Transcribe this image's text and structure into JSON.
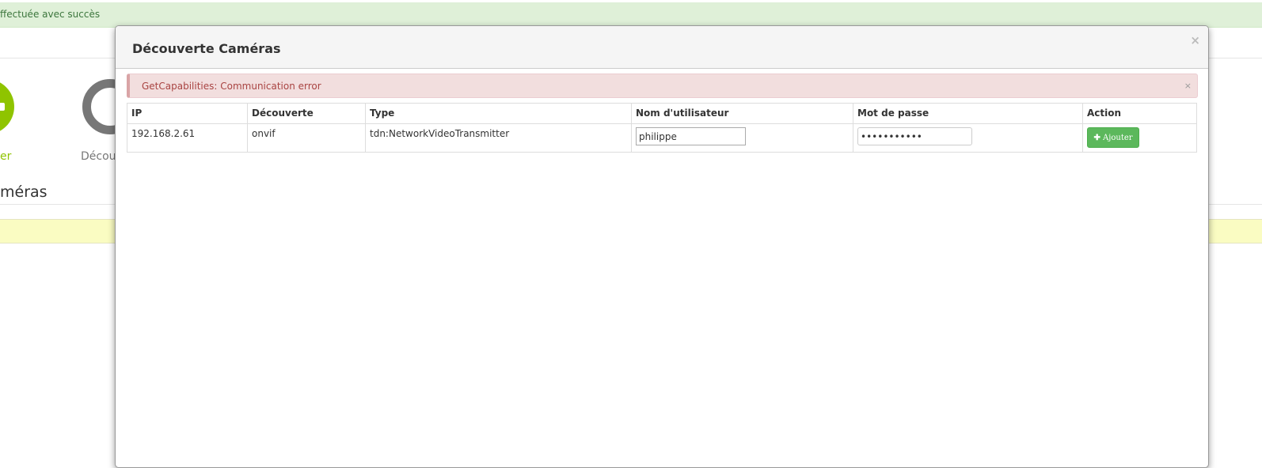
{
  "background": {
    "success_message": "ffectuée avec succès",
    "label_green": "er",
    "label_gray": "Décou",
    "heading": "méras"
  },
  "modal": {
    "title": "Découverte Caméras",
    "close": "×",
    "alert": {
      "message": "GetCapabilities: Communication error",
      "close": "×"
    },
    "table": {
      "headers": [
        "IP",
        "Découverte",
        "Type",
        "Nom d'utilisateur",
        "Mot de passe",
        "Action"
      ],
      "rows": [
        {
          "ip": "192.168.2.61",
          "discovery": "onvif",
          "type": "tdn:NetworkVideoTransmitter",
          "username": "philippe",
          "password": "•••••••••••",
          "action": "Ajouter"
        }
      ]
    },
    "add_icon": "plus-icon"
  },
  "colors": {
    "success_bg": "#dff0d8",
    "error_bg": "#f2dede",
    "button": "#5cb85c",
    "brand_green": "#8fc400"
  }
}
